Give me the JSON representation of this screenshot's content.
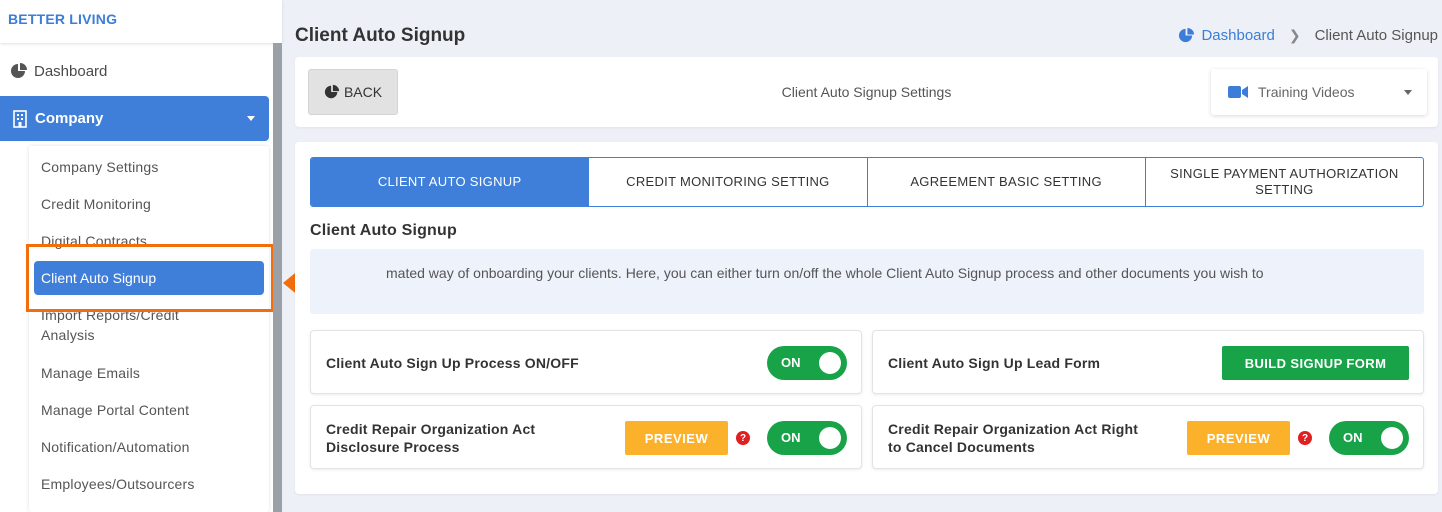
{
  "sidebar": {
    "brand": "BETTER LIVING",
    "dashboard_label": "Dashboard",
    "company_label": "Company",
    "submenu": [
      "Company Settings",
      "Credit Monitoring",
      "Digital Contracts",
      "Client Auto Signup",
      "Import Reports/Credit",
      "Analysis",
      "Manage Emails",
      "Manage Portal Content",
      "Notification/Automation",
      "Employees/Outsourcers"
    ]
  },
  "header": {
    "title": "Client Auto Signup",
    "breadcrumb": {
      "home": "Dashboard",
      "current": "Client Auto Signup"
    }
  },
  "toolbar": {
    "back_label": "BACK",
    "title": "Client Auto Signup Settings",
    "training_label": "Training Videos"
  },
  "tabs": [
    {
      "label": "CLIENT AUTO SIGNUP",
      "active": true
    },
    {
      "label": "CREDIT MONITORING SETTING",
      "active": false
    },
    {
      "label": "AGREEMENT BASIC SETTING",
      "active": false
    },
    {
      "label": "SINGLE PAYMENT AUTHORIZATION SETTING",
      "active": false
    }
  ],
  "section": {
    "title": "Client Auto Signup",
    "info_text": "mated way of onboarding your clients. Here, you can either turn on/off the whole Client Auto Signup process and other documents you wish to"
  },
  "settings": {
    "process": {
      "label": "Client Auto Sign Up Process ON/OFF",
      "toggle": "ON"
    },
    "lead_form": {
      "label": "Client Auto Sign Up Lead Form",
      "button": "BUILD SIGNUP FORM"
    },
    "disclosure": {
      "label_line1": "Credit Repair Organization Act",
      "label_line2": "Disclosure Process",
      "preview": "PREVIEW",
      "help": "?",
      "toggle": "ON"
    },
    "cancel": {
      "label_line1": "Credit Repair Organization Act Right",
      "label_line2": "to Cancel Documents",
      "preview": "PREVIEW",
      "help": "?",
      "toggle": "ON"
    }
  },
  "colors": {
    "primary": "#3f7fd9",
    "success": "#18a349",
    "warning": "#fbb12a",
    "danger": "#e02020",
    "highlight": "#f26d0b"
  },
  "icons": {
    "dashboard": "pie-chart-icon",
    "company": "building-icon",
    "back": "pie-chart-icon",
    "training": "video-camera-icon",
    "help": "question-circle-icon",
    "annotation": "arrow-left-icon"
  }
}
